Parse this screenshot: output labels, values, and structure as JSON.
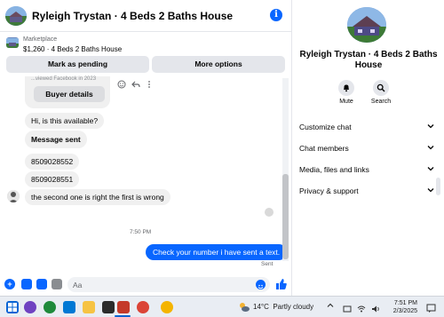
{
  "chat": {
    "title": "Ryleigh Trystan · 4 Beds 2 Baths House",
    "marketplace": {
      "label": "Marketplace",
      "listing": "$1,260 · 4 Beds 2 Baths House",
      "pending_button": "Mark as pending",
      "options_button": "More options"
    },
    "faded_text": "...viewed Facebook in 2023",
    "buyer_details_button": "Buyer details",
    "messages": [
      {
        "text": "Hi, is this available?"
      },
      {
        "text": "Message sent"
      },
      {
        "text": "8509028552"
      },
      {
        "text": "8509028551"
      },
      {
        "text": "the second one is right the first is wrong"
      }
    ],
    "time_separator": "7:50 PM",
    "my_message": "Check your number i have sent a text.",
    "status": "Sent",
    "compose_placeholder": "Aa"
  },
  "details": {
    "name": "Ryleigh Trystan · 4 Beds 2 Baths House",
    "mute_label": "Mute",
    "search_label": "Search",
    "sections": [
      "Customize chat",
      "Chat members",
      "Media, files and links",
      "Privacy & support"
    ]
  },
  "taskbar": {
    "temperature": "14°C",
    "weather": "Partly cloudy",
    "time": "7:51 PM",
    "date": "2/3/2025"
  },
  "colors": {
    "accent": "#0866ff",
    "bubble_grey": "#f0f0f0",
    "button_grey": "#e4e6eb"
  },
  "icons": [
    "info-icon",
    "emoji-icon",
    "reply-icon",
    "more-icon",
    "bell-icon",
    "search-icon",
    "chevron-down-icon",
    "plus-icon",
    "sticker-icon",
    "gif-icon",
    "image-icon",
    "like-icon",
    "windows-icon",
    "notification-icon"
  ]
}
